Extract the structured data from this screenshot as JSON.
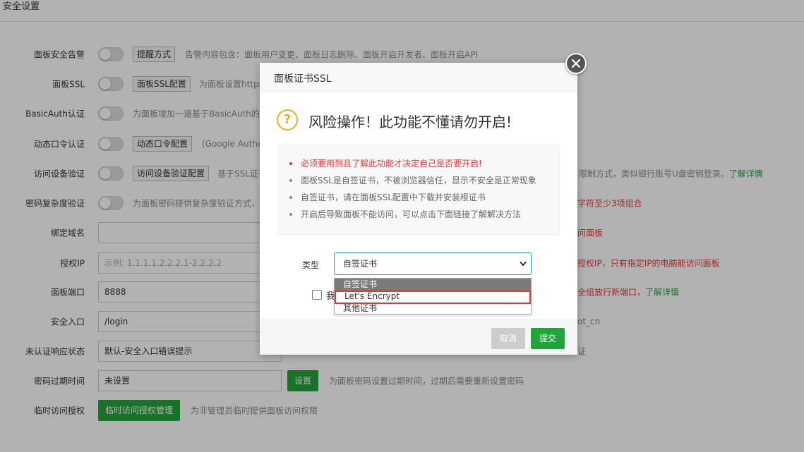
{
  "page": {
    "title": "安全设置"
  },
  "settings": {
    "alert": {
      "label": "面板安全告警",
      "button": "提醒方式",
      "desc": "告警内容包含：面板用户变更、面板日志删除、面板开启开发者、面板开启API"
    },
    "ssl": {
      "label": "面板SSL",
      "button": "面板SSL配置",
      "desc": "为面板设置https"
    },
    "basic_auth": {
      "label": "BasicAuth认证",
      "desc": "为面板增加一道基于BasicAuth的"
    },
    "otp": {
      "label": "动态口令认证",
      "button": "动态口令配置",
      "desc": "(Google Authe"
    },
    "device": {
      "label": "访问设备验证",
      "button": "访问设备验证配置",
      "desc": "基于SSL证书",
      "desc_right": "限制方式，类似银行账号U盘密钥登录。",
      "link": "了解详情"
    },
    "pwd_complex": {
      "label": "密码复杂度验证",
      "desc": "为面板密码提供复杂度验证方式，",
      "desc_right": "字符至少3项组合"
    },
    "domain": {
      "label": "绑定域名",
      "value": "",
      "desc_right": "问面板"
    },
    "ip": {
      "label": "授权IP",
      "placeholder": "示例: 1.1.1.1,2.2.2.1-2.2.2.2",
      "desc_right": "授权IP，只有指定IP的电脑能访问面板"
    },
    "port": {
      "label": "面板端口",
      "value": "8888",
      "desc_right": "全组放行新端口，",
      "link": "了解详情"
    },
    "entry": {
      "label": "安全入口",
      "value": "/login",
      "desc_right": "ot_cn"
    },
    "unauth": {
      "label": "未认证响应状态",
      "value": "默认-安全入口错误提示",
      "desc_right": "证"
    },
    "pwd_expire": {
      "label": "密码过期时间",
      "value": "未设置",
      "button": "设置",
      "desc": "为面板密码设置过期时间，过期后需要重新设置密码"
    },
    "temp_access": {
      "label": "临时访问授权",
      "button": "临时访问授权管理",
      "desc": "为非管理员临时提供面板访问权限"
    }
  },
  "dialog": {
    "title": "面板证书SSL",
    "warning": "风险操作！此功能不懂请勿开启!",
    "notes": [
      "必须要用到且了解此功能才决定自己是否要开启!",
      "面板SSL是自签证书，不被浏览器信任，显示不安全是正常现象",
      "自签证书，请在面板SSL配置中下载并安装根证书",
      "开启后导致面板不能访问，可以点击下面链接了解解决方法"
    ],
    "type_label": "类型",
    "type_value": "自签证书",
    "options": [
      "自签证书",
      "Let's Encrypt",
      "其他证书"
    ],
    "agree_partial": "我",
    "cancel": "取消",
    "submit": "提交"
  },
  "colors": {
    "accent": "#20a53a",
    "danger": "#ee3333",
    "warning": "#f0ad1e"
  }
}
